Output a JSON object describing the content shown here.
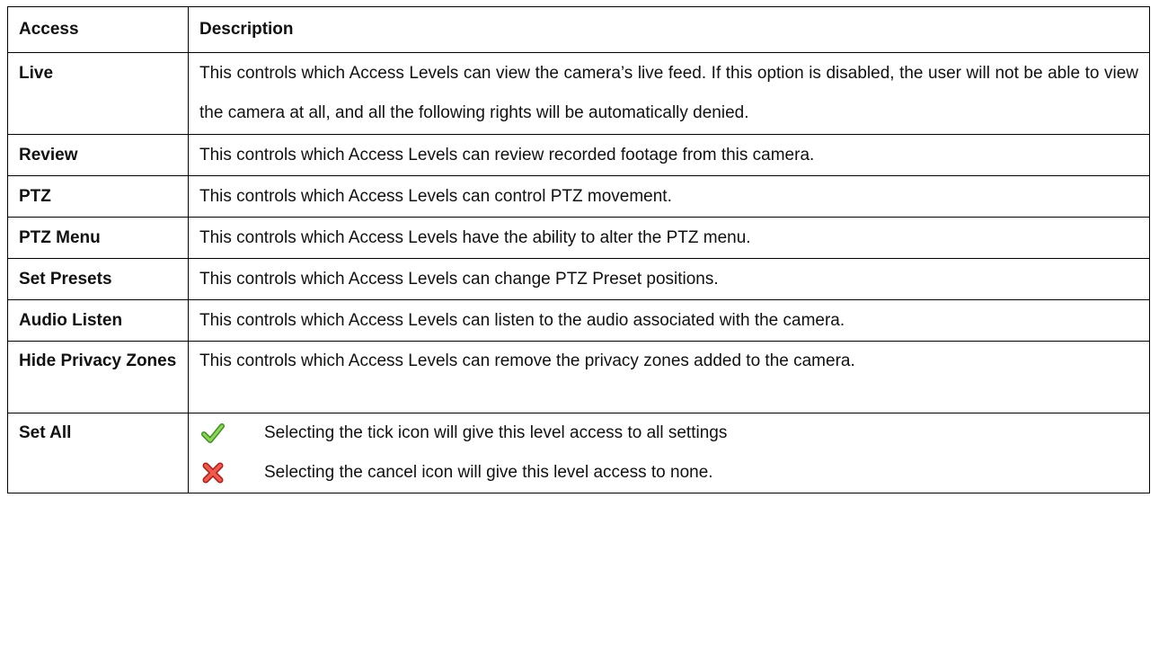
{
  "table": {
    "header": {
      "access": "Access",
      "description": "Description"
    },
    "rows": [
      {
        "access": "Live",
        "description": "This controls which Access Levels can view the camera’s live feed. If this option is disabled, the user will not be able to view the camera at all, and all the following rights will be automatically denied."
      },
      {
        "access": "Review",
        "description": "This controls which Access Levels can review recorded footage from this camera."
      },
      {
        "access": "PTZ",
        "description": "This controls which Access Levels can control PTZ movement."
      },
      {
        "access": "PTZ Menu",
        "description": "This controls which Access Levels have the ability to alter the PTZ menu."
      },
      {
        "access": "Set Presets",
        "description": "This controls which Access Levels can change PTZ Preset positions."
      },
      {
        "access": "Audio Listen",
        "description": "This controls which Access Levels can listen to the audio associated with the camera."
      },
      {
        "access": "Hide Privacy Zones",
        "description": "This controls which Access Levels can remove the privacy zones added to the camera."
      }
    ],
    "set_all": {
      "access": "Set All",
      "tick": {
        "icon": "tick-icon",
        "text": "Selecting the tick icon will give this level access to all settings"
      },
      "cancel": {
        "icon": "cancel-icon",
        "text": "Selecting the cancel icon will give this level access to none."
      }
    }
  },
  "colors": {
    "border": "#000000",
    "tick_green": "#5cb82e",
    "cancel_red": "#d9312b"
  }
}
